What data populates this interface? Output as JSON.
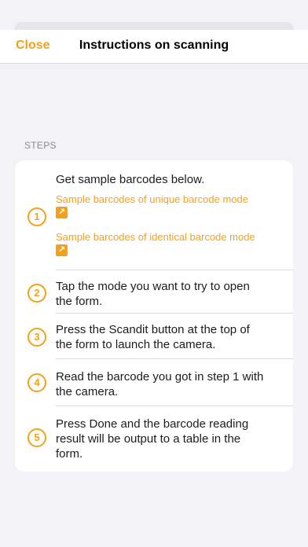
{
  "nav": {
    "close_label": "Close",
    "title": "Instructions on scanning"
  },
  "section": {
    "header": "STEPS"
  },
  "steps": [
    {
      "number": "1",
      "text": "Get sample barcodes below.",
      "links": [
        {
          "label": "Sample barcodes of unique barcode mode",
          "icon": "external-link-icon"
        },
        {
          "label": "Sample barcodes of identical barcode mode",
          "icon": "external-link-icon"
        }
      ]
    },
    {
      "number": "2",
      "lines": [
        "Tap the mode you want to try to open",
        "the form."
      ]
    },
    {
      "number": "3",
      "lines": [
        "Press the Scandit button at the top of",
        "the form to launch the camera."
      ]
    },
    {
      "number": "4",
      "lines": [
        "Read the barcode you got in step 1 with",
        "the camera."
      ]
    },
    {
      "number": "5",
      "lines": [
        "Press Done and the barcode reading",
        "result will be output to a table in the",
        "form."
      ]
    }
  ],
  "colors": {
    "accent": "#f4a11a",
    "background": "#f2f2f7",
    "card": "#ffffff",
    "secondary_text": "#8a8a8e"
  }
}
